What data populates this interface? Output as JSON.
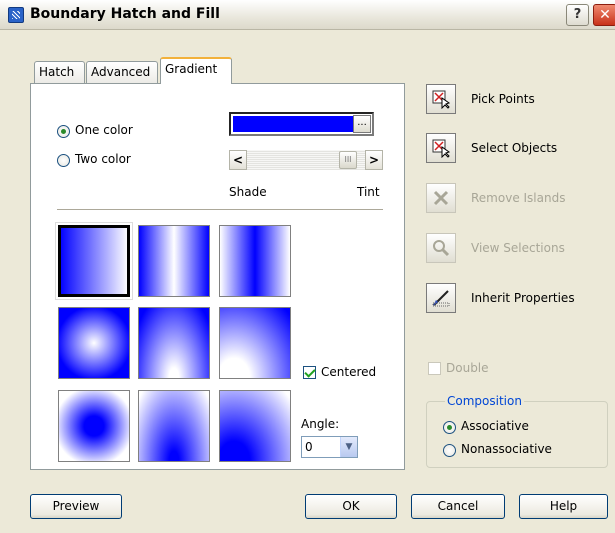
{
  "window": {
    "title": "Boundary Hatch and Fill",
    "help_label": "?",
    "close_label": "✕"
  },
  "tabs": [
    {
      "label": "Hatch",
      "active": false
    },
    {
      "label": "Advanced",
      "active": false
    },
    {
      "label": "Gradient",
      "active": true
    }
  ],
  "gradient": {
    "one_color_label": "One color",
    "two_color_label": "Two color",
    "color_mode": "One color",
    "color": "#0000ff",
    "color_button_label": "...",
    "shade_label": "Shade",
    "tint_label": "Tint",
    "left_arrow": "<",
    "right_arrow": ">",
    "thumb_glyph": "III",
    "centered_label": "Centered",
    "centered_checked": true,
    "angle_label": "Angle:",
    "angle_value": "0",
    "selected_pattern": "linear",
    "patterns": [
      "linear",
      "cylinder",
      "inverted-cylinder",
      "spherical",
      "hemispherical",
      "curved",
      "inverted-spherical",
      "inverted-hemispherical",
      "inverted-curved"
    ]
  },
  "side": {
    "pick_points_label": "Pick Points",
    "select_objects_label": "Select Objects",
    "remove_islands_label": "Remove Islands",
    "view_selections_label": "View Selections",
    "inherit_properties_label": "Inherit Properties",
    "double_label": "Double",
    "composition_title": "Composition",
    "associative_label": "Associative",
    "nonassociative_label": "Nonassociative",
    "composition_value": "Associative"
  },
  "buttons": {
    "preview_label": "Preview",
    "ok_label": "OK",
    "cancel_label": "Cancel",
    "help_label": "Help"
  },
  "colors": {
    "accent": "#0000ff",
    "dialog_bg": "#ece9d8",
    "group_title": "#0046d5"
  }
}
